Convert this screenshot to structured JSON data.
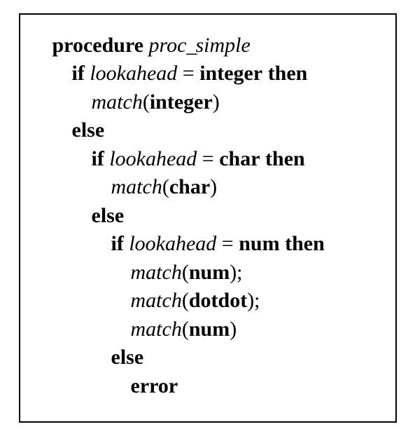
{
  "code": {
    "l1_procedure": "procedure",
    "l1_procname": "proc",
    "l1_underscore": "_",
    "l1_procname2": "simple",
    "l2_if": "if",
    "l2_lookahead": "lookahead",
    "l2_eq": " = ",
    "l2_integer": "integer",
    "l2_then": " then",
    "l3_match": "match",
    "l3_open": "(",
    "l3_integer": "integer",
    "l3_close": ")",
    "l4_else": "else",
    "l5_if": "if",
    "l5_lookahead": "lookahead",
    "l5_eq": " = ",
    "l5_char": "char",
    "l5_then": " then",
    "l6_match": "match",
    "l6_open": "(",
    "l6_char": "char",
    "l6_close": ")",
    "l7_else": "else",
    "l8_if": "if",
    "l8_lookahead": "lookahead",
    "l8_eq": " = ",
    "l8_num": "num",
    "l8_then": " then",
    "l9_match": "match",
    "l9_open": "(",
    "l9_num": "num",
    "l9_close": ");",
    "l10_match": "match",
    "l10_open": "(",
    "l10_dotdot": "dotdot",
    "l10_close": ");",
    "l11_match": "match",
    "l11_open": "(",
    "l11_num": "num",
    "l11_close": ")",
    "l12_else": "else",
    "l13_error": "error"
  }
}
